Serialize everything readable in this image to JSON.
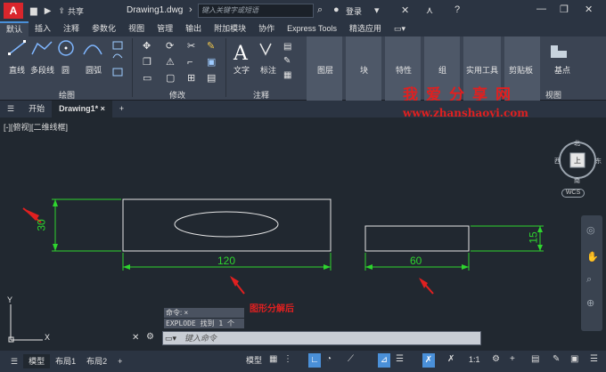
{
  "titlebar": {
    "logo": "A",
    "share_label": "共享",
    "doc_title": "Drawing1.dwg",
    "search_placeholder": "键入关键字或短语",
    "login_label": "登录"
  },
  "ribbon_tabs": [
    "默认",
    "插入",
    "注释",
    "参数化",
    "视图",
    "管理",
    "输出",
    "附加模块",
    "协作",
    "Express Tools",
    "精选应用"
  ],
  "ribbon": {
    "draw_tools": [
      "直线",
      "多段线",
      "圆",
      "圆弧"
    ],
    "panel_titles": {
      "draw": "绘图",
      "modify": "修改",
      "annotation": "注释",
      "view": "视图"
    },
    "annot_tools": [
      "文字",
      "标注"
    ],
    "big_tools": [
      "图层",
      "块",
      "特性",
      "组",
      "实用工具",
      "剪贴板",
      "基点"
    ]
  },
  "file_tabs": [
    "开始",
    "Drawing1*"
  ],
  "viewport": {
    "label": "[-][俯视][二维线框]",
    "dims": {
      "left_height": "30",
      "left_width": "120",
      "right_width": "60",
      "right_height": "15"
    },
    "annotation": "图形分解后",
    "viewcube": {
      "top": "北",
      "west": "西",
      "east": "东",
      "south": "南",
      "center": "上"
    },
    "wcs": "WCS"
  },
  "watermark": {
    "text": "我爱分享网",
    "url": "www.zhanshaoyi.com"
  },
  "command": {
    "history1": "命令: ×",
    "history2": "EXPLODE 找到 1 个",
    "placeholder": "键入命令"
  },
  "statusbar": {
    "layout_tabs": [
      "模型",
      "布局1",
      "布局2"
    ],
    "model_label": "模型",
    "scale": "1:1"
  }
}
